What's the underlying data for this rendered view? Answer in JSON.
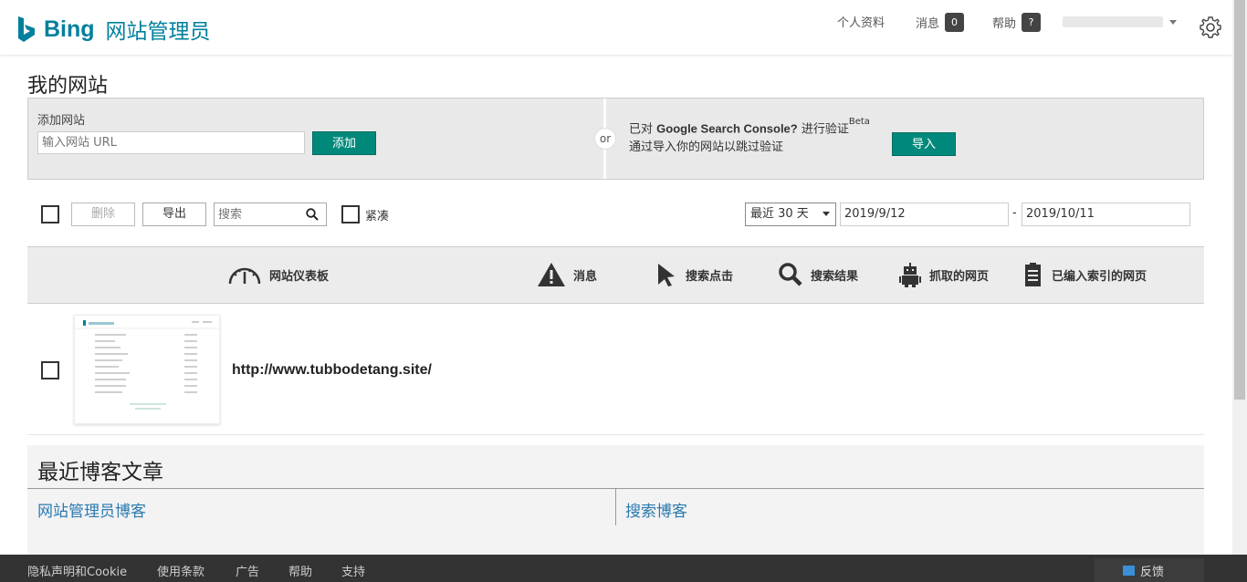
{
  "header": {
    "brand": "Bing",
    "product": "网站管理员",
    "nav": {
      "profile": "个人资料",
      "messages": "消息",
      "messages_count": "0",
      "help": "帮助",
      "help_badge": "?"
    },
    "brand_color": "#00809d"
  },
  "page": {
    "title": "我的网站"
  },
  "add_site": {
    "label": "添加网站",
    "input_placeholder": "输入网站 URL",
    "add_button": "添加",
    "or_label": "or",
    "import_line1_prefix": "已对 ",
    "import_line1_brand": "Google Search Console?",
    "import_line1_suffix": " 进行验证",
    "import_beta": "Beta",
    "import_line2": "通过导入你的网站以跳过验证",
    "import_button": "导入"
  },
  "toolbar": {
    "delete_label": "删除",
    "export_label": "导出",
    "search_placeholder": "搜索",
    "compact_label": "紧凑",
    "range_select": "最近 30 天",
    "date_from": "2019/9/12",
    "date_to": "2019/10/11",
    "date_sep": "-"
  },
  "columns": [
    {
      "label": "网站仪表板",
      "icon": "gauge-icon"
    },
    {
      "label": "消息",
      "icon": "warning-icon"
    },
    {
      "label": "搜索点击",
      "icon": "cursor-icon"
    },
    {
      "label": "搜索结果",
      "icon": "magnifier-icon"
    },
    {
      "label": "抓取的网页",
      "icon": "robot-icon"
    },
    {
      "label": "已编入索引的网页",
      "icon": "document-list-icon"
    }
  ],
  "sites": [
    {
      "url": "http://www.tubbodetang.site/"
    }
  ],
  "blog": {
    "heading": "最近博客文章",
    "col1": "网站管理员博客",
    "col2": "搜索博客"
  },
  "footer": {
    "links": [
      "隐私声明和Cookie",
      "使用条款",
      "广告",
      "帮助",
      "支持"
    ],
    "feedback": "反馈"
  },
  "colors": {
    "accent_button": "#00897b",
    "link": "#2a7ab0",
    "footer_bg": "#333333"
  }
}
